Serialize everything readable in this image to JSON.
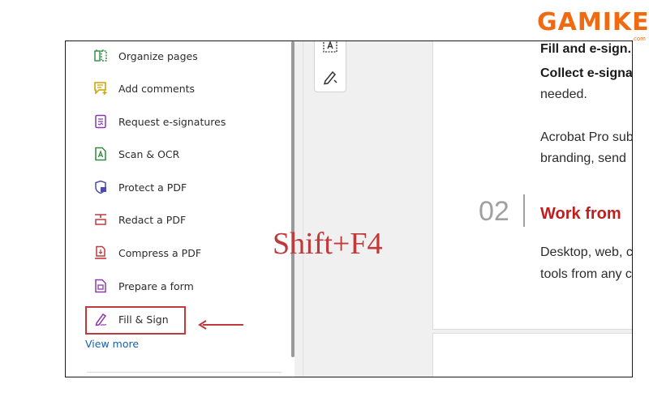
{
  "logo": {
    "text": "GAMIKEY",
    "sub": ".com"
  },
  "tools": [
    {
      "label": "Organize pages",
      "icon": "organize-pages-icon",
      "color": "#2e8a3e"
    },
    {
      "label": "Add comments",
      "icon": "comment-icon",
      "color": "#c9a100"
    },
    {
      "label": "Request e-signatures",
      "icon": "request-signature-icon",
      "color": "#8a3aa8"
    },
    {
      "label": "Scan & OCR",
      "icon": "scan-ocr-icon",
      "color": "#2e8a3e"
    },
    {
      "label": "Protect a PDF",
      "icon": "protect-pdf-icon",
      "color": "#4a4ab0"
    },
    {
      "label": "Redact a PDF",
      "icon": "redact-pdf-icon",
      "color": "#c0393b"
    },
    {
      "label": "Compress a PDF",
      "icon": "compress-pdf-icon",
      "color": "#c0393b"
    },
    {
      "label": "Prepare a form",
      "icon": "prepare-form-icon",
      "color": "#8a3aa8"
    },
    {
      "label": "Fill & Sign",
      "icon": "fill-sign-icon",
      "color": "#8a3aa8"
    }
  ],
  "view_more": "View more",
  "shortcut": "Shift+F4",
  "document": {
    "line1": "Fill and e-sign.",
    "line2": "Collect e-signa",
    "line3": "needed.",
    "line4": "Acrobat Pro sub",
    "line5": "branding, send",
    "section_number": "02",
    "section_title": "Work from",
    "line6": "Desktop, web, c",
    "line7": "tools from any c"
  },
  "colors": {
    "highlight": "#c0393b",
    "link": "#1a5fa8",
    "section_title": "#c01e1e",
    "brand": "#f06a12"
  }
}
